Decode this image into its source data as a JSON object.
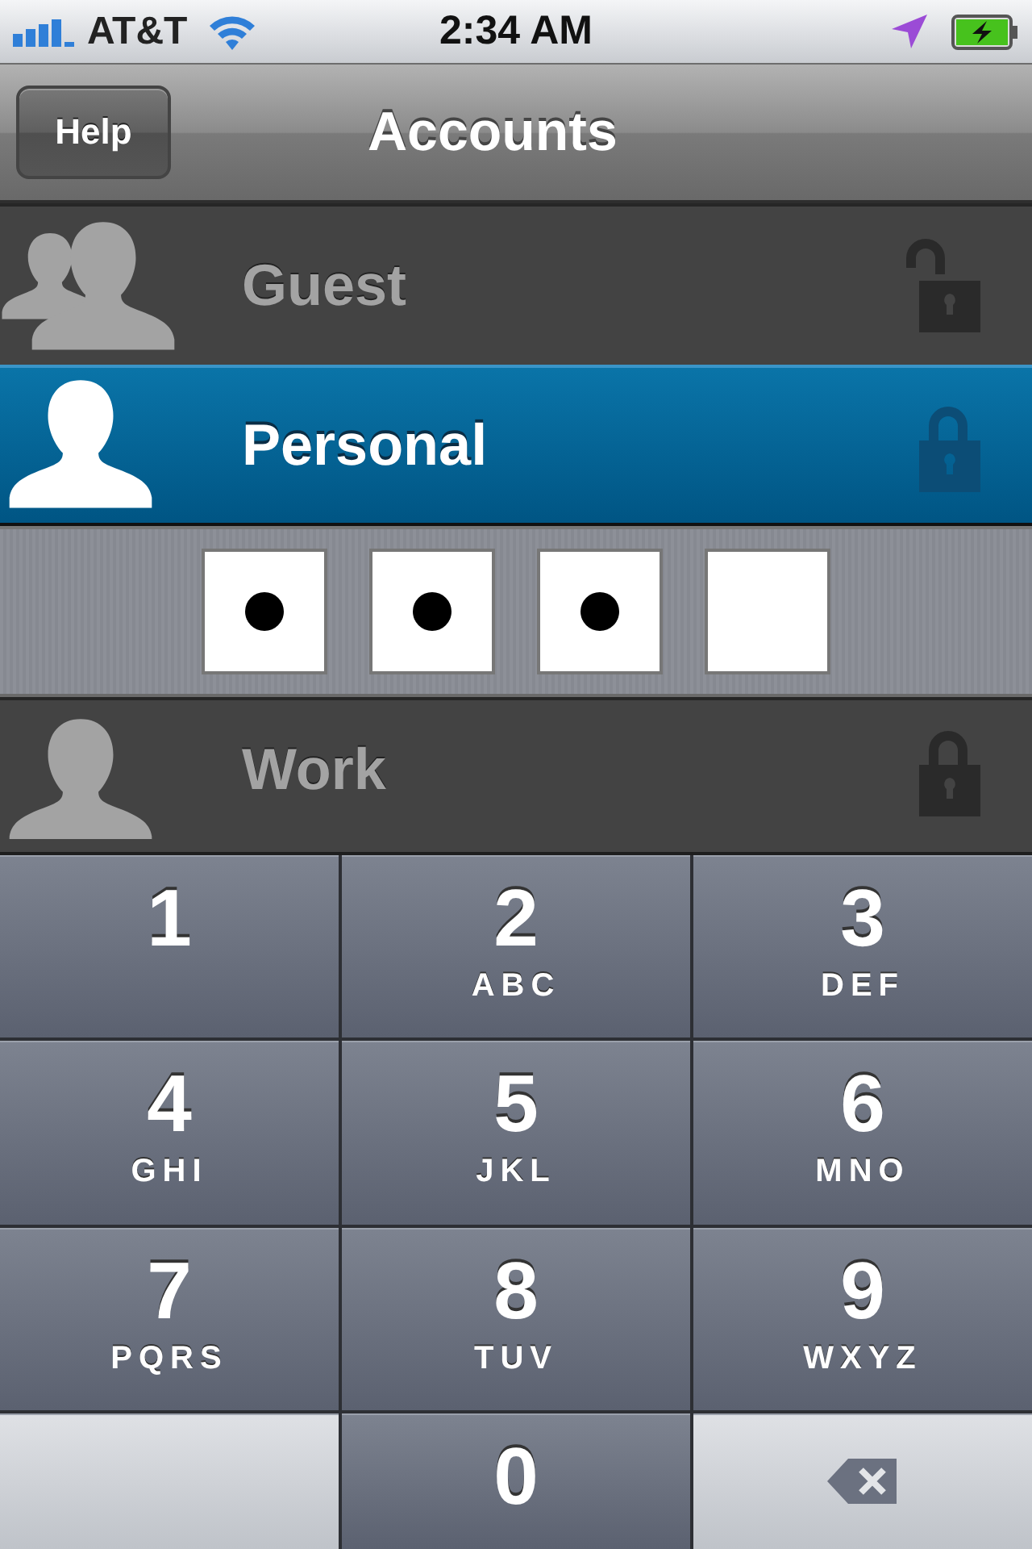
{
  "status_bar": {
    "carrier": "AT&T",
    "time": "2:34 AM"
  },
  "nav": {
    "help_button": "Help",
    "title": "Accounts"
  },
  "accounts": [
    {
      "name": "Guest",
      "kind": "group",
      "locked": false,
      "selected": false
    },
    {
      "name": "Personal",
      "kind": "single",
      "locked": true,
      "selected": true
    },
    {
      "name": "Work",
      "kind": "single",
      "locked": true,
      "selected": false
    }
  ],
  "pin": {
    "digits": [
      {
        "filled": true
      },
      {
        "filled": true
      },
      {
        "filled": true
      },
      {
        "filled": false
      }
    ]
  },
  "keypad": [
    {
      "kind": "digit",
      "digit": "1"
    },
    {
      "kind": "digit",
      "digit": "2",
      "letters": "ABC"
    },
    {
      "kind": "digit",
      "digit": "3",
      "letters": "DEF"
    },
    {
      "kind": "digit",
      "digit": "4",
      "letters": "GHI"
    },
    {
      "kind": "digit",
      "digit": "5",
      "letters": "JKL"
    },
    {
      "kind": "digit",
      "digit": "6",
      "letters": "MNO"
    },
    {
      "kind": "digit",
      "digit": "7",
      "letters": "PQRS"
    },
    {
      "kind": "digit",
      "digit": "8",
      "letters": "TUV"
    },
    {
      "kind": "digit",
      "digit": "9",
      "letters": "WXYZ"
    },
    {
      "kind": "blank"
    },
    {
      "kind": "digit",
      "digit": "0"
    },
    {
      "kind": "delete"
    }
  ]
}
